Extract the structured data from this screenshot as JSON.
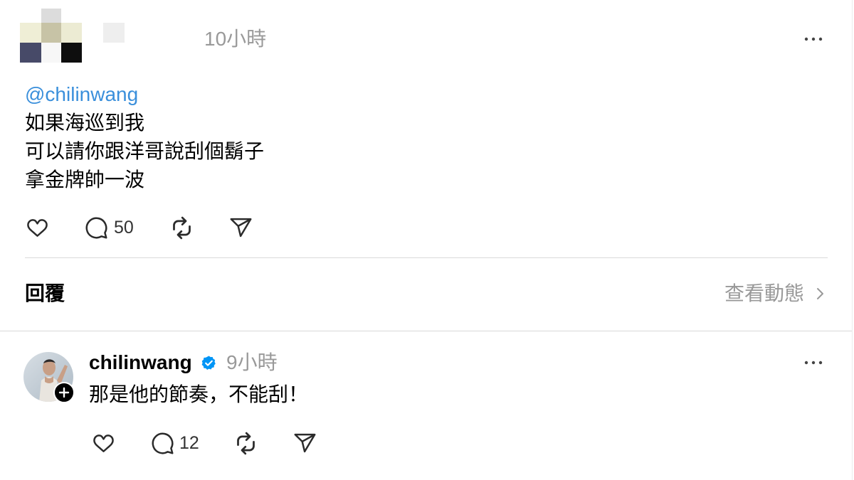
{
  "post": {
    "timestamp": "10小時",
    "mention": "@chilinwang",
    "lines": [
      "如果海巡到我",
      "可以請你跟洋哥說刮個鬍子",
      "拿金牌帥一波"
    ],
    "more_icon": "more-icon",
    "actions": {
      "like_icon": "heart-icon",
      "comment_icon": "comment-icon",
      "comment_count": "50",
      "repost_icon": "repost-icon",
      "share_icon": "send-icon"
    }
  },
  "replies_section": {
    "title": "回覆",
    "view_activity_label": "查看動態",
    "chevron_icon": "chevron-right-icon"
  },
  "reply": {
    "username": "chilinwang",
    "verified_icon": "verified-badge-icon",
    "timestamp": "9小時",
    "text": "那是他的節奏，不能刮！",
    "more_icon": "more-icon",
    "follow_icon": "plus-icon",
    "actions": {
      "like_icon": "heart-icon",
      "comment_icon": "comment-icon",
      "comment_count": "12",
      "repost_icon": "repost-icon",
      "share_icon": "send-icon"
    }
  },
  "colors": {
    "text": "#000000",
    "muted": "#999999",
    "link": "#3a8fdb",
    "verified": "#0095f6",
    "divider": "#dbdbdb",
    "icon": "#2b2b2b",
    "background": "#ffffff"
  }
}
